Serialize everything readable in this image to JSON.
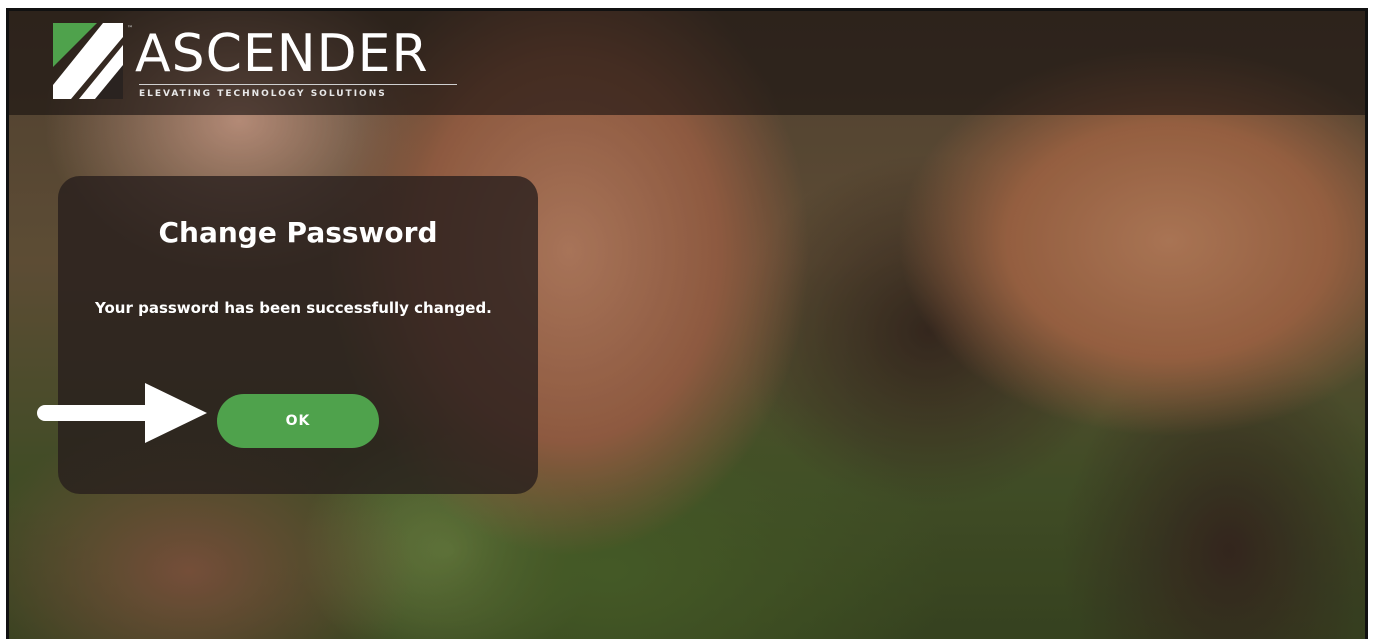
{
  "app": {
    "brand": "ASCENDER",
    "tagline": "ELEVATING TECHNOLOGY SOLUTIONS",
    "trademark": "™"
  },
  "dialog": {
    "title": "Change Password",
    "message": "Your password has been successfully changed.",
    "ok_label": "OK"
  },
  "colors": {
    "ok_button": "#4fa24c",
    "logo_green": "#4fa24c",
    "dialog_bg": "rgba(38,30,28,0.78)"
  },
  "icons": {
    "logo": "ascender-logo-icon",
    "pointer": "arrow-right-icon"
  }
}
